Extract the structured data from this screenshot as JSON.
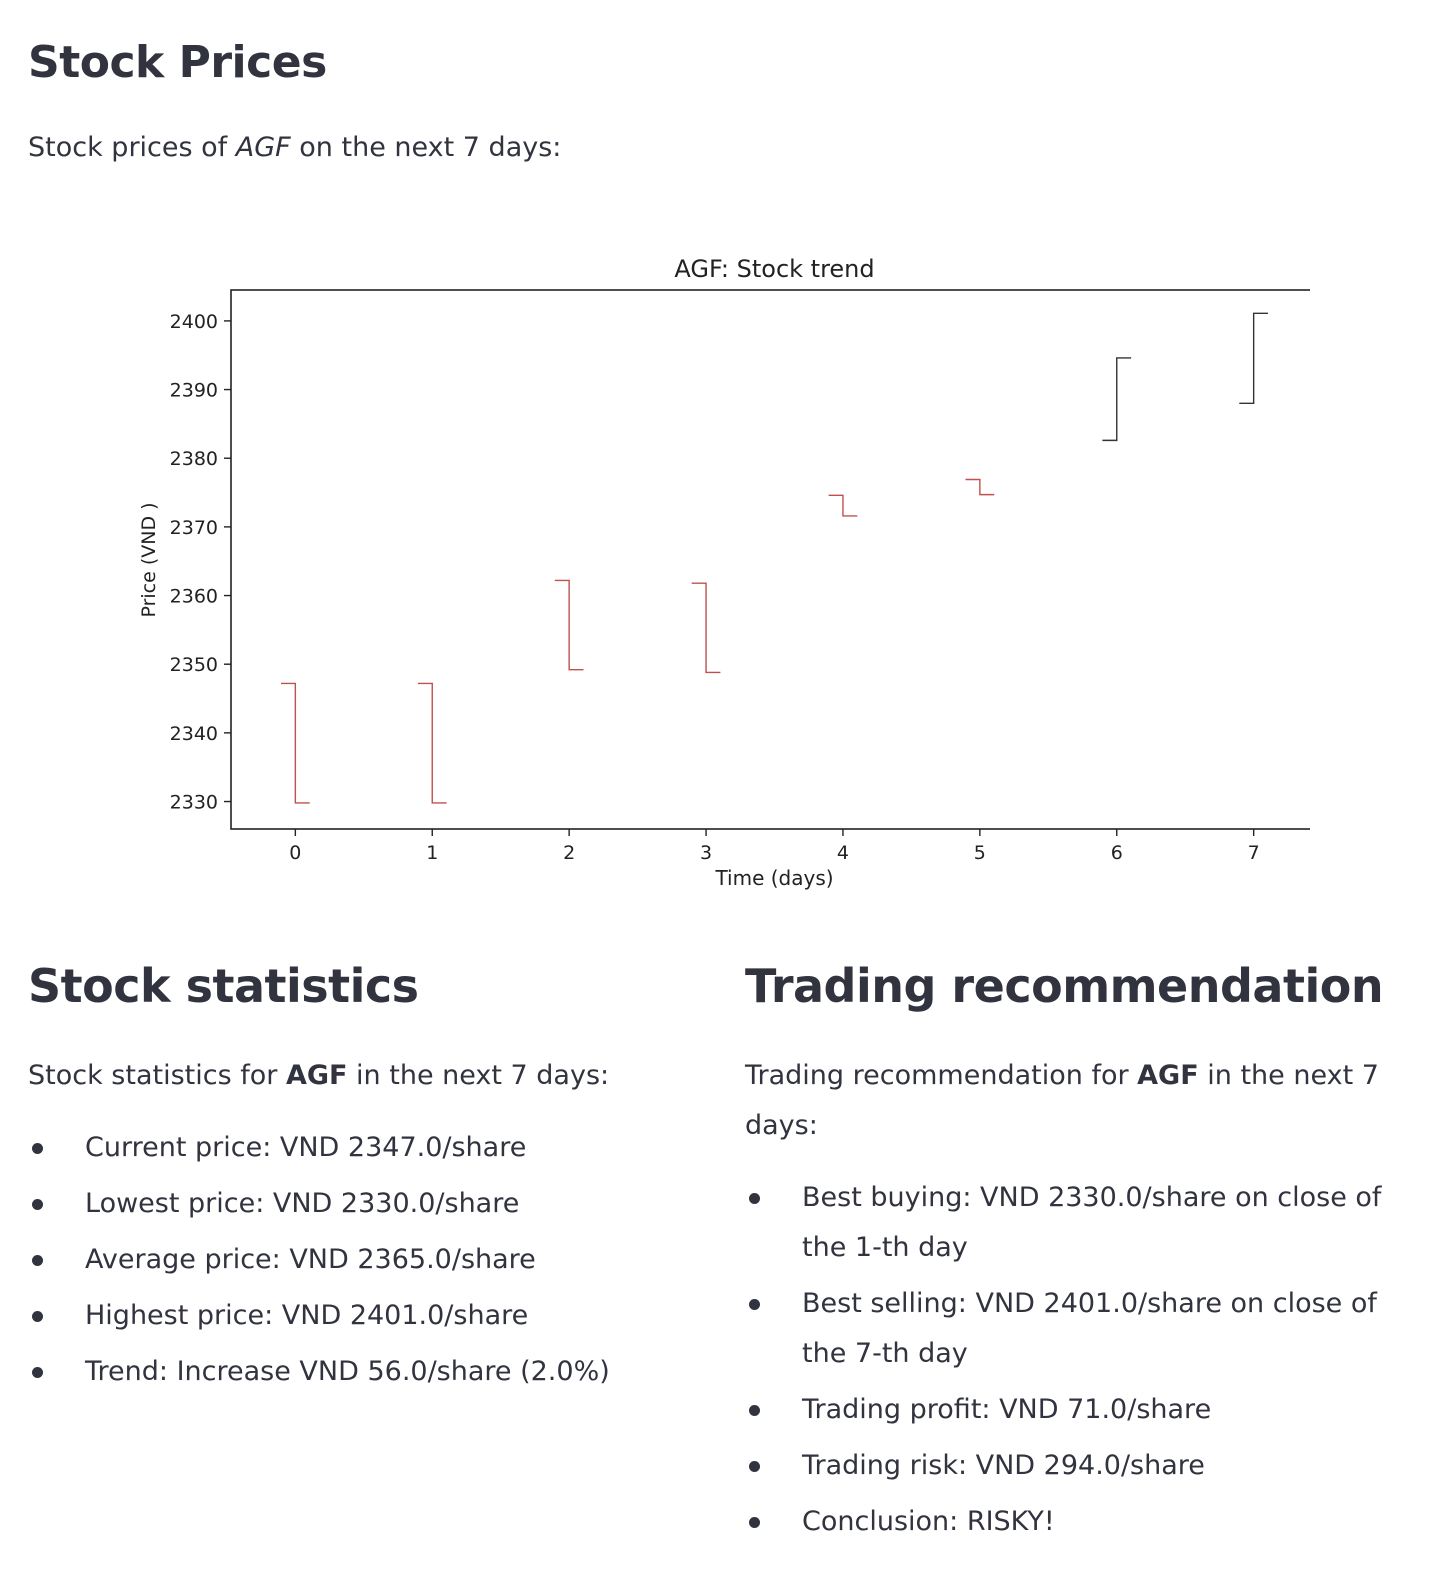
{
  "header": {
    "title": "Stock Prices",
    "intro_prefix": "Stock prices of ",
    "intro_ticker": "AGF",
    "intro_suffix": " on the next 7 days:"
  },
  "chart_data": {
    "type": "candlestick",
    "title": "AGF: Stock trend",
    "xlabel": "Time (days)",
    "ylabel": "Price (VND )",
    "x_ticks": [
      0,
      1,
      2,
      3,
      4,
      5,
      6,
      7
    ],
    "y_ticks": [
      2330,
      2340,
      2350,
      2360,
      2370,
      2380,
      2390,
      2400
    ],
    "xlim": [
      -0.47,
      7.47
    ],
    "ylim": [
      2326,
      2404.5
    ],
    "grid": false,
    "colors": {
      "down": "#c0504d",
      "up": "#333333"
    },
    "points": [
      {
        "x": 0,
        "open": 2347.2,
        "close": 2329.8
      },
      {
        "x": 1,
        "open": 2347.2,
        "close": 2329.8
      },
      {
        "x": 2,
        "open": 2362.2,
        "close": 2349.2
      },
      {
        "x": 3,
        "open": 2361.8,
        "close": 2348.8
      },
      {
        "x": 4,
        "open": 2374.6,
        "close": 2371.6
      },
      {
        "x": 5,
        "open": 2376.9,
        "close": 2374.7
      },
      {
        "x": 6,
        "open": 2382.6,
        "close": 2394.6
      },
      {
        "x": 7,
        "open": 2388.0,
        "close": 2401.1
      }
    ]
  },
  "statistics": {
    "heading": "Stock statistics",
    "intro_prefix": "Stock statistics for ",
    "ticker": "AGF",
    "intro_suffix": " in the next 7 days:",
    "items": [
      "Current price: VND 2347.0/share",
      "Lowest price: VND 2330.0/share",
      "Average price: VND 2365.0/share",
      "Highest price: VND 2401.0/share",
      "Trend: Increase VND 56.0/share (2.0%)"
    ]
  },
  "recommendation": {
    "heading": "Trading recommendation",
    "intro_prefix": "Trading recommendation for ",
    "ticker": "AGF",
    "intro_suffix": " in the next 7 days:",
    "items": [
      "Best buying: VND 2330.0/share on close of the 1-th day",
      "Best selling: VND 2401.0/share on close of the 7-th day",
      "Trading profit: VND 71.0/share",
      "Trading risk: VND 294.0/share",
      "Conclusion: RISKY!"
    ]
  }
}
